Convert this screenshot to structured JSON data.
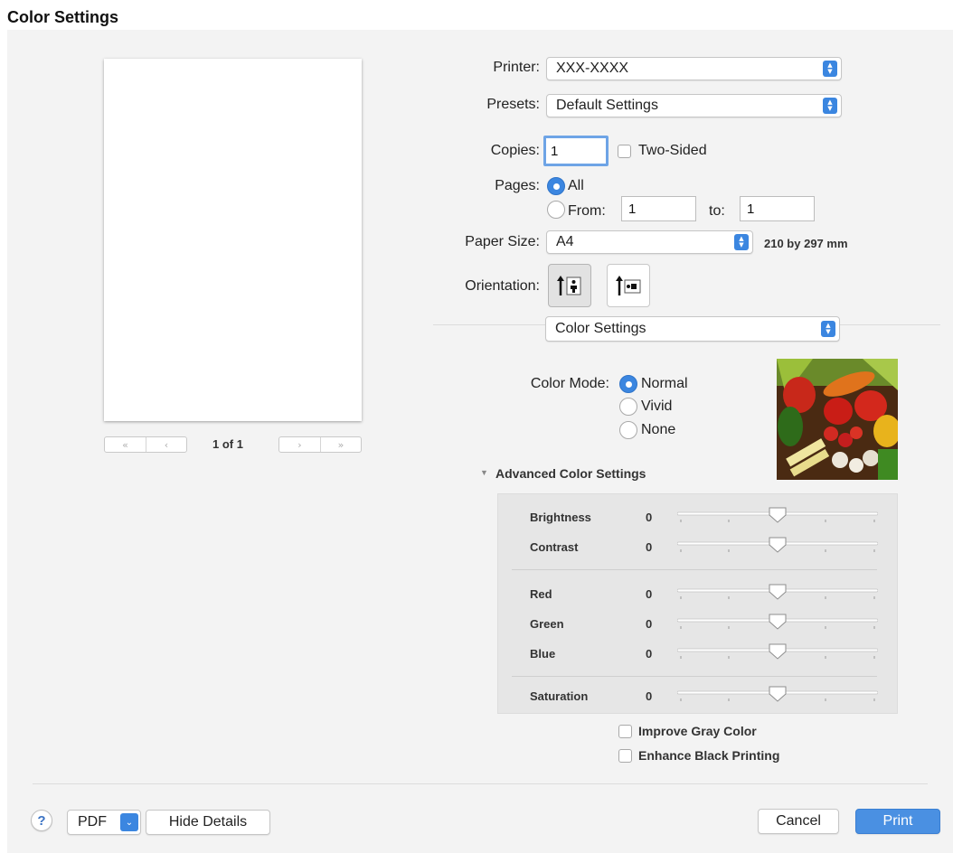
{
  "doc_title": "Color Settings",
  "preview": {
    "first_page_label": "«",
    "prev_page_label": "‹",
    "next_page_label": "›",
    "last_page_label": "»",
    "page_indicator": "1 of 1"
  },
  "printer": {
    "label": "Printer:",
    "value": "XXX-XXXX"
  },
  "presets": {
    "label": "Presets:",
    "value": "Default Settings"
  },
  "copies": {
    "label": "Copies:",
    "value": "1",
    "two_sided_label": "Two-Sided",
    "two_sided_checked": false
  },
  "pages": {
    "label": "Pages:",
    "all_label": "All",
    "from_label": "From:",
    "from_value": "1",
    "to_label": "to:",
    "to_value": "1",
    "selected": "All"
  },
  "paper_size": {
    "label": "Paper Size:",
    "value": "A4",
    "dimensions": "210 by 297 mm"
  },
  "orientation": {
    "label": "Orientation:",
    "selected": "portrait"
  },
  "section_menu": {
    "value": "Color Settings"
  },
  "color_mode": {
    "label": "Color Mode:",
    "options": [
      "Normal",
      "Vivid",
      "None"
    ],
    "selected": "Normal"
  },
  "advanced": {
    "toggle_label": "Advanced Color Settings",
    "expanded": true,
    "sliders": [
      {
        "label": "Brightness",
        "value": "0"
      },
      {
        "label": "Contrast",
        "value": "0"
      },
      {
        "label": "Red",
        "value": "0"
      },
      {
        "label": "Green",
        "value": "0"
      },
      {
        "label": "Blue",
        "value": "0"
      },
      {
        "label": "Saturation",
        "value": "0"
      }
    ]
  },
  "options": {
    "improve_gray_label": "Improve Gray Color",
    "enhance_black_label": "Enhance Black Printing"
  },
  "footer": {
    "help_label": "?",
    "pdf_label": "PDF",
    "hide_details_label": "Hide Details",
    "cancel_label": "Cancel",
    "print_label": "Print"
  },
  "colors": {
    "accent": "#3b86e0",
    "primary_button": "#4a90e2",
    "panel": "#e6e6e6",
    "dialog_bg": "#f3f3f3"
  }
}
